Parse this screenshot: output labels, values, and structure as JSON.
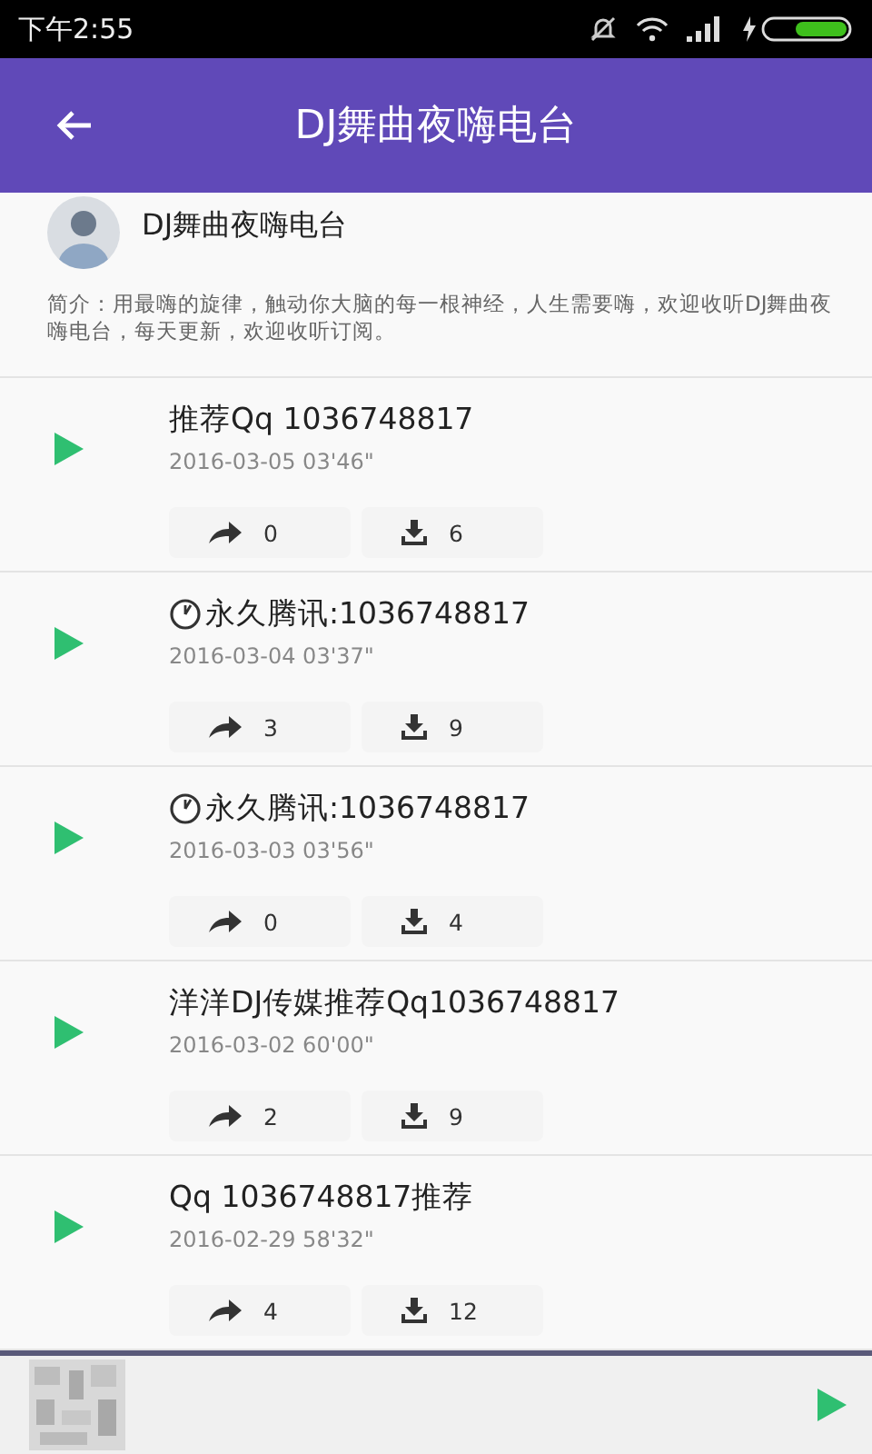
{
  "status_bar": {
    "time": "下午2:55"
  },
  "app_bar": {
    "title": "DJ舞曲夜嗨电台"
  },
  "profile": {
    "name": "DJ舞曲夜嗨电台",
    "intro": "简介：用最嗨的旋律，触动你大脑的每一根神经，人生需要嗨，欢迎收听DJ舞曲夜嗨电台，每天更新，欢迎收听订阅。"
  },
  "tracks": [
    {
      "kind": "plain",
      "title": "推荐Qq 1036748817",
      "date": "2016-03-05",
      "duration": "03'46\"",
      "shares": "0",
      "downloads": "6"
    },
    {
      "kind": "clock",
      "title": "永久腾讯:1036748817",
      "date": "2016-03-04",
      "duration": "03'37\"",
      "shares": "3",
      "downloads": "9"
    },
    {
      "kind": "clock",
      "title": "永久腾讯:1036748817",
      "date": "2016-03-03",
      "duration": "03'56\"",
      "shares": "0",
      "downloads": "4"
    },
    {
      "kind": "plain",
      "title": "洋洋DJ传媒推荐Qq1036748817",
      "date": "2016-03-02",
      "duration": "60'00\"",
      "shares": "2",
      "downloads": "9"
    },
    {
      "kind": "plain",
      "title": "Qq 1036748817推荐",
      "date": "2016-02-29",
      "duration": "58'32\"",
      "shares": "4",
      "downloads": "12"
    }
  ]
}
